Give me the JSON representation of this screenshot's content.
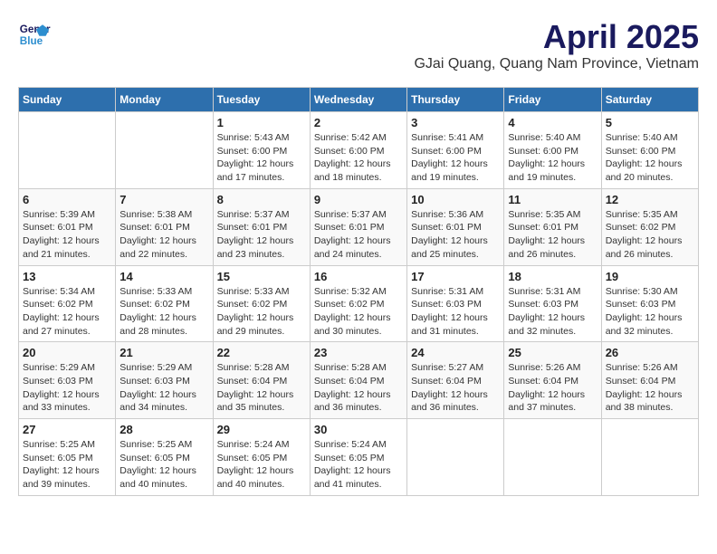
{
  "logo": {
    "line1": "General",
    "line2": "Blue"
  },
  "title": "April 2025",
  "subtitle": "GJai Quang, Quang Nam Province, Vietnam",
  "days_of_week": [
    "Sunday",
    "Monday",
    "Tuesday",
    "Wednesday",
    "Thursday",
    "Friday",
    "Saturday"
  ],
  "weeks": [
    [
      {
        "day": null
      },
      {
        "day": null
      },
      {
        "day": 1,
        "sunrise": "5:43 AM",
        "sunset": "6:00 PM",
        "daylight": "12 hours and 17 minutes."
      },
      {
        "day": 2,
        "sunrise": "5:42 AM",
        "sunset": "6:00 PM",
        "daylight": "12 hours and 18 minutes."
      },
      {
        "day": 3,
        "sunrise": "5:41 AM",
        "sunset": "6:00 PM",
        "daylight": "12 hours and 19 minutes."
      },
      {
        "day": 4,
        "sunrise": "5:40 AM",
        "sunset": "6:00 PM",
        "daylight": "12 hours and 19 minutes."
      },
      {
        "day": 5,
        "sunrise": "5:40 AM",
        "sunset": "6:00 PM",
        "daylight": "12 hours and 20 minutes."
      }
    ],
    [
      {
        "day": 6,
        "sunrise": "5:39 AM",
        "sunset": "6:01 PM",
        "daylight": "12 hours and 21 minutes."
      },
      {
        "day": 7,
        "sunrise": "5:38 AM",
        "sunset": "6:01 PM",
        "daylight": "12 hours and 22 minutes."
      },
      {
        "day": 8,
        "sunrise": "5:37 AM",
        "sunset": "6:01 PM",
        "daylight": "12 hours and 23 minutes."
      },
      {
        "day": 9,
        "sunrise": "5:37 AM",
        "sunset": "6:01 PM",
        "daylight": "12 hours and 24 minutes."
      },
      {
        "day": 10,
        "sunrise": "5:36 AM",
        "sunset": "6:01 PM",
        "daylight": "12 hours and 25 minutes."
      },
      {
        "day": 11,
        "sunrise": "5:35 AM",
        "sunset": "6:01 PM",
        "daylight": "12 hours and 26 minutes."
      },
      {
        "day": 12,
        "sunrise": "5:35 AM",
        "sunset": "6:02 PM",
        "daylight": "12 hours and 26 minutes."
      }
    ],
    [
      {
        "day": 13,
        "sunrise": "5:34 AM",
        "sunset": "6:02 PM",
        "daylight": "12 hours and 27 minutes."
      },
      {
        "day": 14,
        "sunrise": "5:33 AM",
        "sunset": "6:02 PM",
        "daylight": "12 hours and 28 minutes."
      },
      {
        "day": 15,
        "sunrise": "5:33 AM",
        "sunset": "6:02 PM",
        "daylight": "12 hours and 29 minutes."
      },
      {
        "day": 16,
        "sunrise": "5:32 AM",
        "sunset": "6:02 PM",
        "daylight": "12 hours and 30 minutes."
      },
      {
        "day": 17,
        "sunrise": "5:31 AM",
        "sunset": "6:03 PM",
        "daylight": "12 hours and 31 minutes."
      },
      {
        "day": 18,
        "sunrise": "5:31 AM",
        "sunset": "6:03 PM",
        "daylight": "12 hours and 32 minutes."
      },
      {
        "day": 19,
        "sunrise": "5:30 AM",
        "sunset": "6:03 PM",
        "daylight": "12 hours and 32 minutes."
      }
    ],
    [
      {
        "day": 20,
        "sunrise": "5:29 AM",
        "sunset": "6:03 PM",
        "daylight": "12 hours and 33 minutes."
      },
      {
        "day": 21,
        "sunrise": "5:29 AM",
        "sunset": "6:03 PM",
        "daylight": "12 hours and 34 minutes."
      },
      {
        "day": 22,
        "sunrise": "5:28 AM",
        "sunset": "6:04 PM",
        "daylight": "12 hours and 35 minutes."
      },
      {
        "day": 23,
        "sunrise": "5:28 AM",
        "sunset": "6:04 PM",
        "daylight": "12 hours and 36 minutes."
      },
      {
        "day": 24,
        "sunrise": "5:27 AM",
        "sunset": "6:04 PM",
        "daylight": "12 hours and 36 minutes."
      },
      {
        "day": 25,
        "sunrise": "5:26 AM",
        "sunset": "6:04 PM",
        "daylight": "12 hours and 37 minutes."
      },
      {
        "day": 26,
        "sunrise": "5:26 AM",
        "sunset": "6:04 PM",
        "daylight": "12 hours and 38 minutes."
      }
    ],
    [
      {
        "day": 27,
        "sunrise": "5:25 AM",
        "sunset": "6:05 PM",
        "daylight": "12 hours and 39 minutes."
      },
      {
        "day": 28,
        "sunrise": "5:25 AM",
        "sunset": "6:05 PM",
        "daylight": "12 hours and 40 minutes."
      },
      {
        "day": 29,
        "sunrise": "5:24 AM",
        "sunset": "6:05 PM",
        "daylight": "12 hours and 40 minutes."
      },
      {
        "day": 30,
        "sunrise": "5:24 AM",
        "sunset": "6:05 PM",
        "daylight": "12 hours and 41 minutes."
      },
      {
        "day": null
      },
      {
        "day": null
      },
      {
        "day": null
      }
    ]
  ],
  "labels": {
    "sunrise_prefix": "Sunrise: ",
    "sunset_prefix": "Sunset: ",
    "daylight_prefix": "Daylight: "
  }
}
